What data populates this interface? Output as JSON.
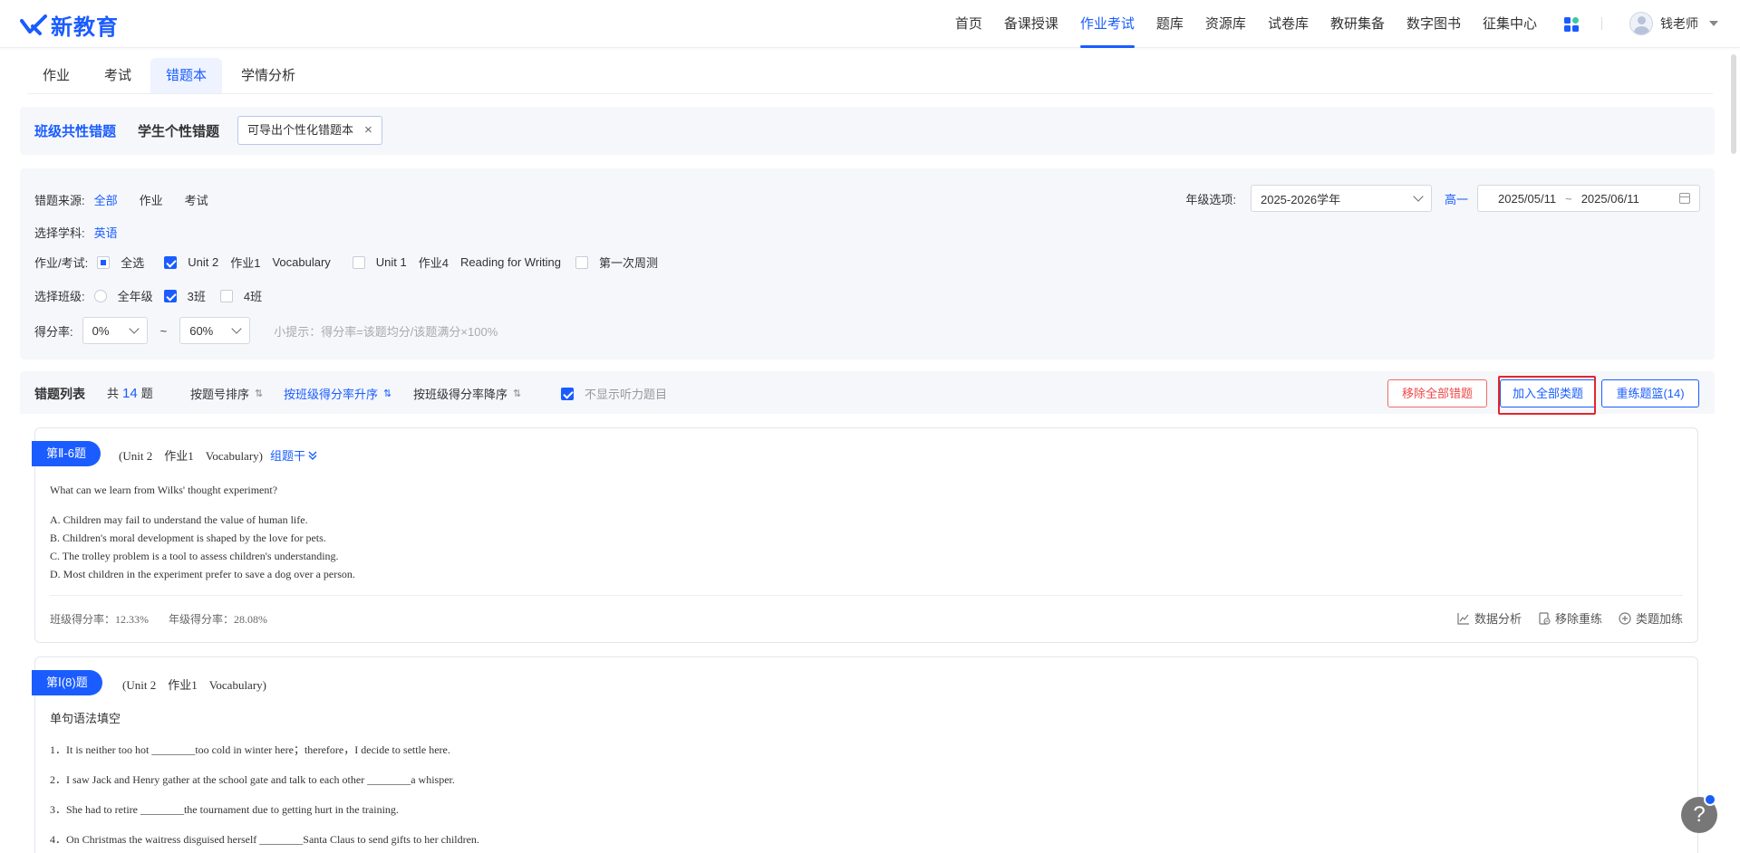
{
  "brand": {
    "logo_text": "新教育"
  },
  "nav": {
    "items": [
      {
        "label": "首页",
        "active": false
      },
      {
        "label": "备课授课",
        "active": false
      },
      {
        "label": "作业考试",
        "active": true
      },
      {
        "label": "题库",
        "active": false
      },
      {
        "label": "资源库",
        "active": false
      },
      {
        "label": "试卷库",
        "active": false
      },
      {
        "label": "教研集备",
        "active": false
      },
      {
        "label": "数字图书",
        "active": false
      },
      {
        "label": "征集中心",
        "active": false
      }
    ],
    "user_name": "钱老师"
  },
  "tabs": [
    {
      "label": "作业",
      "active": false
    },
    {
      "label": "考试",
      "active": false
    },
    {
      "label": "错题本",
      "active": true
    },
    {
      "label": "学情分析",
      "active": false
    }
  ],
  "subhead": {
    "class_common": "班级共性错题",
    "student_personal": "学生个性错题",
    "tag_label": "可导出个性化错题本",
    "tag_close": "×"
  },
  "filters": {
    "source_label": "错题来源:",
    "source_options": [
      "全部",
      "作业",
      "考试"
    ],
    "subject_label": "选择学科:",
    "subject_value": "英语",
    "hw_label": "作业/考试:",
    "hw_select_all": "全选",
    "hw_items": [
      {
        "parts": [
          "Unit 2",
          "作业1",
          "Vocabulary"
        ],
        "checked": true
      },
      {
        "parts": [
          "Unit 1",
          "作业4",
          "Reading for Writing"
        ],
        "checked": false
      },
      {
        "parts": [
          "第一次周测"
        ],
        "checked": false
      }
    ],
    "class_label": "选择班级:",
    "class_options": [
      {
        "label": "全年级",
        "type": "radio",
        "checked": false
      },
      {
        "label": "3班",
        "type": "checkbox",
        "checked": true
      },
      {
        "label": "4班",
        "type": "checkbox",
        "checked": false
      }
    ],
    "score_label": "得分率:",
    "score_min": "0%",
    "score_sep": "~",
    "score_max": "60%",
    "score_hint": "小提示：得分率=该题均分/该题满分×100%",
    "year_label": "年级选项:",
    "year_value": "2025-2026学年",
    "grade_value": "高一",
    "date_start": "2025/05/11",
    "date_sep": "~",
    "date_end": "2025/06/11"
  },
  "list": {
    "title": "错题列表",
    "count_prefix": "共",
    "count": "14",
    "count_suffix": "题",
    "sorts": [
      {
        "label": "按题号排序",
        "active": false
      },
      {
        "label": "按班级得分率升序",
        "active": true
      },
      {
        "label": "按班级得分率降序",
        "active": false
      }
    ],
    "hide_listening_label": "不显示听力题目",
    "hide_listening_checked": true,
    "btn_remove_all": "移除全部错题",
    "btn_add_all": "加入全部类题",
    "btn_retrain": "重练题篮(14)"
  },
  "questions": [
    {
      "badge": "第Ⅱ-6题",
      "meta": "(Unit 2　作业1　Vocabulary)",
      "group_label": "组题干",
      "stem": "What can we learn from Wilks' thought experiment?",
      "options": [
        "A. Children may fail to understand the value of human life.",
        "B. Children's moral development is shaped by the love for pets.",
        "C. The trolley problem is a tool to assess children's understanding.",
        "D. Most children in the experiment prefer to save a dog over a person."
      ],
      "class_rate_label": "班级得分率：",
      "class_rate": "12.33%",
      "grade_rate_label": "年级得分率：",
      "grade_rate": "28.08%",
      "actions": [
        "数据分析",
        "移除重练",
        "类题加练"
      ]
    },
    {
      "badge": "第Ⅰ(8)题",
      "meta": "(Unit 2　作业1　Vocabulary)",
      "title": "单句语法填空",
      "lines": [
        "1．It is neither too hot ________too cold in winter here；therefore，I decide to settle here.",
        "2．I saw Jack and Henry gather at the school gate and talk to each other ________a whisper.",
        "3．She had to retire ________the tournament due to getting hurt in the training.",
        "4．On Christmas the waitress disguised herself ________Santa Claus to send gifts to her children."
      ]
    }
  ],
  "help": {
    "label": "?"
  },
  "colors": {
    "accent": "#1a5cff",
    "danger": "#f04848",
    "panel_bg": "#f5f7fb"
  }
}
